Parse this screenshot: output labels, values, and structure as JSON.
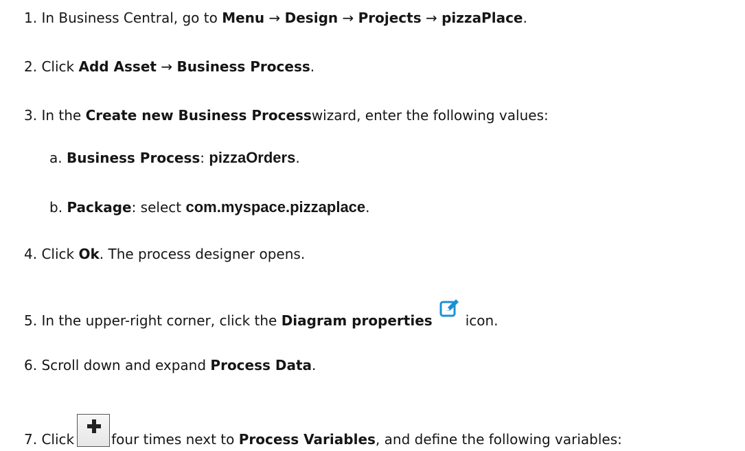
{
  "steps": [
    {
      "num": "1.",
      "pre": "In Business Central, go to ",
      "menu": "Menu",
      "arrow": "→",
      "design": "Design",
      "projects": "Projects",
      "project": "pizzaPlace",
      "end": "."
    },
    {
      "num": "2.",
      "pre": "Click ",
      "add_asset": "Add Asset",
      "arrow": "→",
      "business_process": "Business Process",
      "end": "."
    },
    {
      "num": "3.",
      "pre": "In the ",
      "wizard": "Create new Business Process",
      "post": "wizard, enter the following values:"
    },
    {
      "num": "a.",
      "label": "Business Process",
      "sep": ": ",
      "value": "pizzaOrders",
      "end": "."
    },
    {
      "num": "b.",
      "label": "Package",
      "sep": ": select ",
      "value": "com.myspace.pizzaplace",
      "end": "."
    },
    {
      "num": "4.",
      "pre": "Click ",
      "ok": "Ok",
      "post": ". The process designer opens."
    },
    {
      "num": "5.",
      "pre": "In the upper-right corner, click the ",
      "diagram_properties": "Diagram properties",
      "post": "icon.",
      "icon": "edit-icon",
      "icon_color": "#1a8fd6"
    },
    {
      "num": "6.",
      "pre": "Scroll down and expand ",
      "process_data": "Process Data",
      "end": "."
    },
    {
      "num": "7.",
      "pre": "Click",
      "post1": "four times next to ",
      "process_variables": "Process Variables",
      "post2": ", and define the following variables:",
      "icon": "plus-icon"
    }
  ]
}
